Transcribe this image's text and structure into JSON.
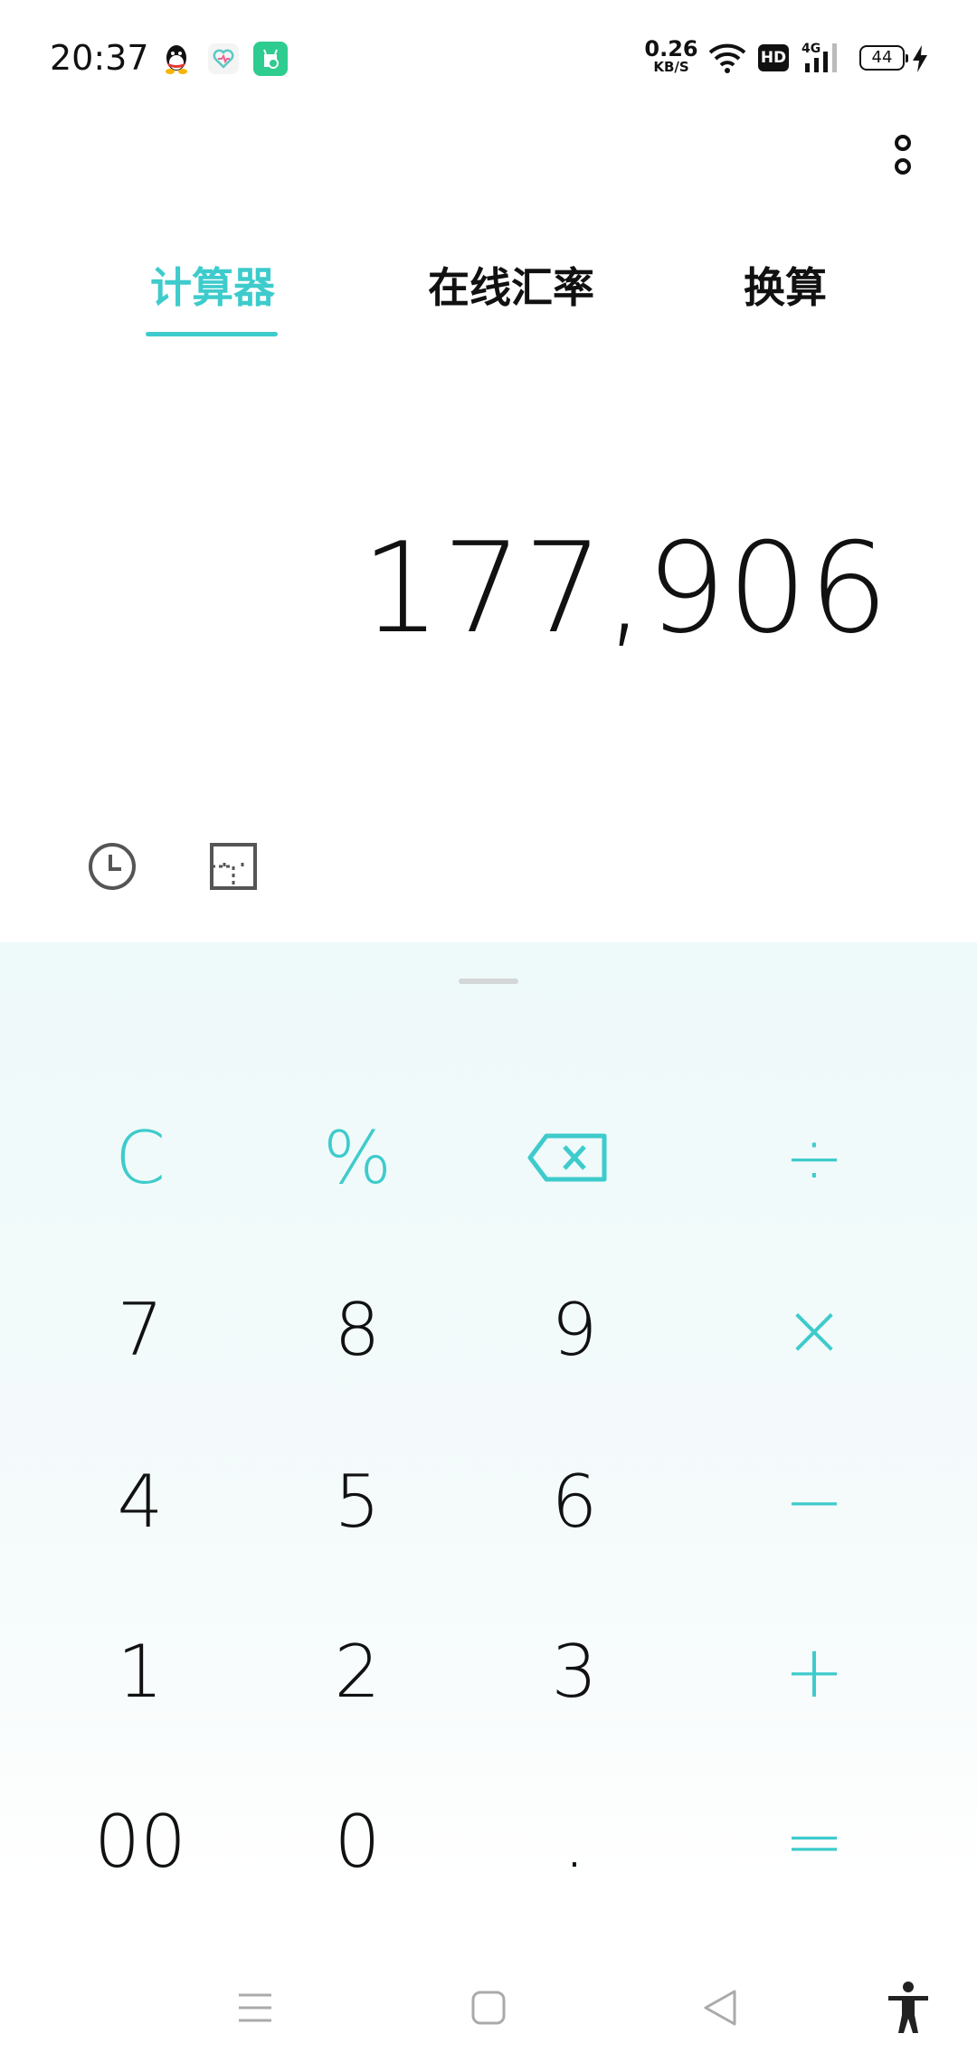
{
  "status_bar": {
    "time": "20:37",
    "network_speed_value": "0.26",
    "network_speed_unit": "KB/S",
    "hd_label": "HD",
    "network_type": "4G",
    "battery": "44"
  },
  "tabs": [
    {
      "label": "计算器",
      "active": true
    },
    {
      "label": "在线汇率",
      "active": false
    },
    {
      "label": "换算",
      "active": false
    }
  ],
  "display": {
    "value": "177,906"
  },
  "keypad": {
    "row1": [
      "C",
      "%",
      "⌫",
      "÷"
    ],
    "row2": [
      "7",
      "8",
      "9",
      "×"
    ],
    "row3": [
      "4",
      "5",
      "6",
      "−"
    ],
    "row4": [
      "1",
      "2",
      "3",
      "+"
    ],
    "row5": [
      "00",
      "0",
      ".",
      "="
    ]
  },
  "colors": {
    "accent": "#3ecbcc",
    "keypad_background": "#eef9fa",
    "text": "#111111"
  },
  "icons": {
    "more": "more-vert-icon",
    "history": "clock-icon",
    "unit": "ruler-icon",
    "backspace": "backspace-icon",
    "nav_menu": "menu-icon",
    "nav_home": "home-icon",
    "nav_back": "back-icon",
    "accessibility": "accessibility-icon"
  }
}
